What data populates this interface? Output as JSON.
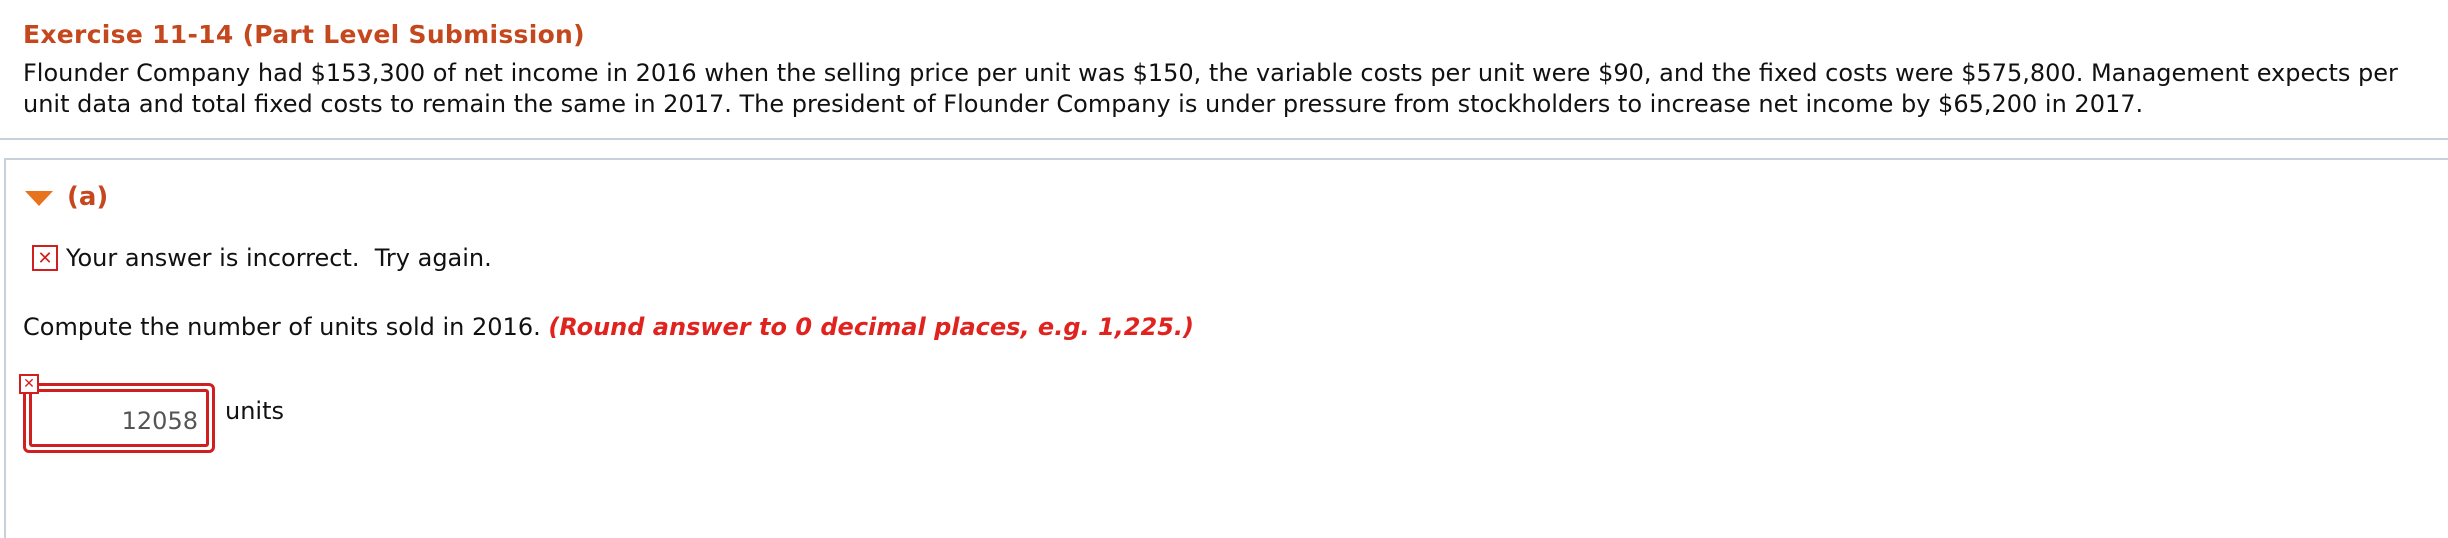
{
  "exercise": {
    "title": "Exercise 11-14 (Part Level Submission)",
    "body": "Flounder Company had $153,300 of net income in 2016 when the selling price per unit was $150, the variable costs per unit were $90, and the fixed costs were $575,800. Management expects per unit data and total fixed costs to remain the same in 2017. The president of Flounder Company is under pressure from stockholders to increase net income by $65,200 in 2017."
  },
  "part": {
    "label": "(a)",
    "feedback_icon": "x-mark-icon",
    "feedback_text": "Your answer is incorrect.  Try again.",
    "question": "Compute the number of units sold in 2016. ",
    "hint": "(Round answer to 0 decimal places, e.g. 1,225.)",
    "answer_value": "12058",
    "units_label": "units"
  },
  "colors": {
    "title": "#c4471d",
    "error": "#d01f1f",
    "hint": "#e0231f",
    "toggle": "#e8731f",
    "border": "#c7d1dc"
  }
}
